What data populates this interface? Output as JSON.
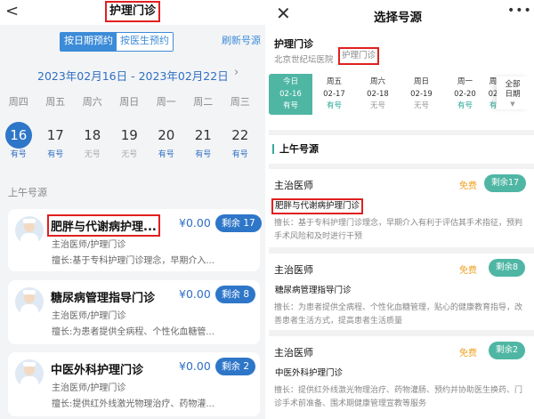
{
  "left": {
    "back": "<",
    "title": "护理门诊",
    "tabs": [
      "按日期预约",
      "按医生预约"
    ],
    "refresh": "刷新号源",
    "date_range": "2023年02月16日 - 2023年02月22日",
    "weekdays": [
      "周四",
      "周五",
      "周六",
      "周日",
      "周一",
      "周二",
      "周三"
    ],
    "days": [
      {
        "num": "16",
        "status": "有号",
        "avail": true
      },
      {
        "num": "17",
        "status": "有号",
        "avail": true
      },
      {
        "num": "18",
        "status": "无号",
        "avail": false
      },
      {
        "num": "19",
        "status": "无号",
        "avail": false
      },
      {
        "num": "20",
        "status": "有号",
        "avail": true
      },
      {
        "num": "21",
        "status": "有号",
        "avail": true
      },
      {
        "num": "22",
        "status": "有号",
        "avail": true
      }
    ],
    "section": "上午号源",
    "cards": [
      {
        "name": "肥胖与代谢病护理...",
        "price": "¥0.00",
        "remain": "剩余 17",
        "role": "主治医师/护理门诊",
        "spec": "擅长:基于专科护理门诊理念，早期介入...",
        "highlight": true
      },
      {
        "name": "糖尿病管理指导门诊",
        "price": "¥0.00",
        "remain": "剩余 8",
        "role": "主治医师/护理门诊",
        "spec": "擅长:为患者提供全病程、个性化血糖管...",
        "highlight": false
      },
      {
        "name": "中医外科护理门诊",
        "price": "¥0.00",
        "remain": "剩余 2",
        "role": "主治医师/护理门诊",
        "spec": "擅长:提供红外线激光物理治疗、药物灌...",
        "highlight": false
      }
    ]
  },
  "right": {
    "close": "✕",
    "title": "选择号源",
    "more": "•••",
    "dept": "护理门诊",
    "hospital": "北京世纪坛医院",
    "hosp_sub": "护理门诊",
    "days": [
      {
        "w": "今日",
        "d": "02-16",
        "s": "有号",
        "avail": true,
        "today": true
      },
      {
        "w": "周五",
        "d": "02-17",
        "s": "有号",
        "avail": true,
        "today": false
      },
      {
        "w": "周六",
        "d": "02-18",
        "s": "无号",
        "avail": false,
        "today": false
      },
      {
        "w": "周日",
        "d": "02-19",
        "s": "无号",
        "avail": false,
        "today": false
      },
      {
        "w": "周一",
        "d": "02-20",
        "s": "有号",
        "avail": true,
        "today": false
      },
      {
        "w": "周",
        "d": "02",
        "s": "有",
        "avail": true,
        "today": false
      }
    ],
    "all_date": "全部日期",
    "section": "上午号源",
    "cards": [
      {
        "rank": "主治医师",
        "fee": "免费",
        "remain": "剩余17",
        "name": "肥胖与代谢病护理门诊",
        "desc": "擅长：基于专科护理门诊理念，早期介入有利于评估其手术指征，预判手术风险和及时进行干预",
        "highlight": true
      },
      {
        "rank": "主治医师",
        "fee": "免费",
        "remain": "剩余8",
        "name": "糖尿病管理指导门诊",
        "desc": "擅长：为患者提供全病程、个性化血糖管理，贴心的健康教育指导，改善患者生活方式，提高患者生活质量",
        "highlight": false
      },
      {
        "rank": "主治医师",
        "fee": "免费",
        "remain": "剩余2",
        "name": "中医外科护理门诊",
        "desc": "擅长：提供红外线激光物理治疗、药物灌肠、预约并协助医生换药、门诊手术前准备、围术期健康管理宣教等服务",
        "highlight": false
      }
    ]
  }
}
